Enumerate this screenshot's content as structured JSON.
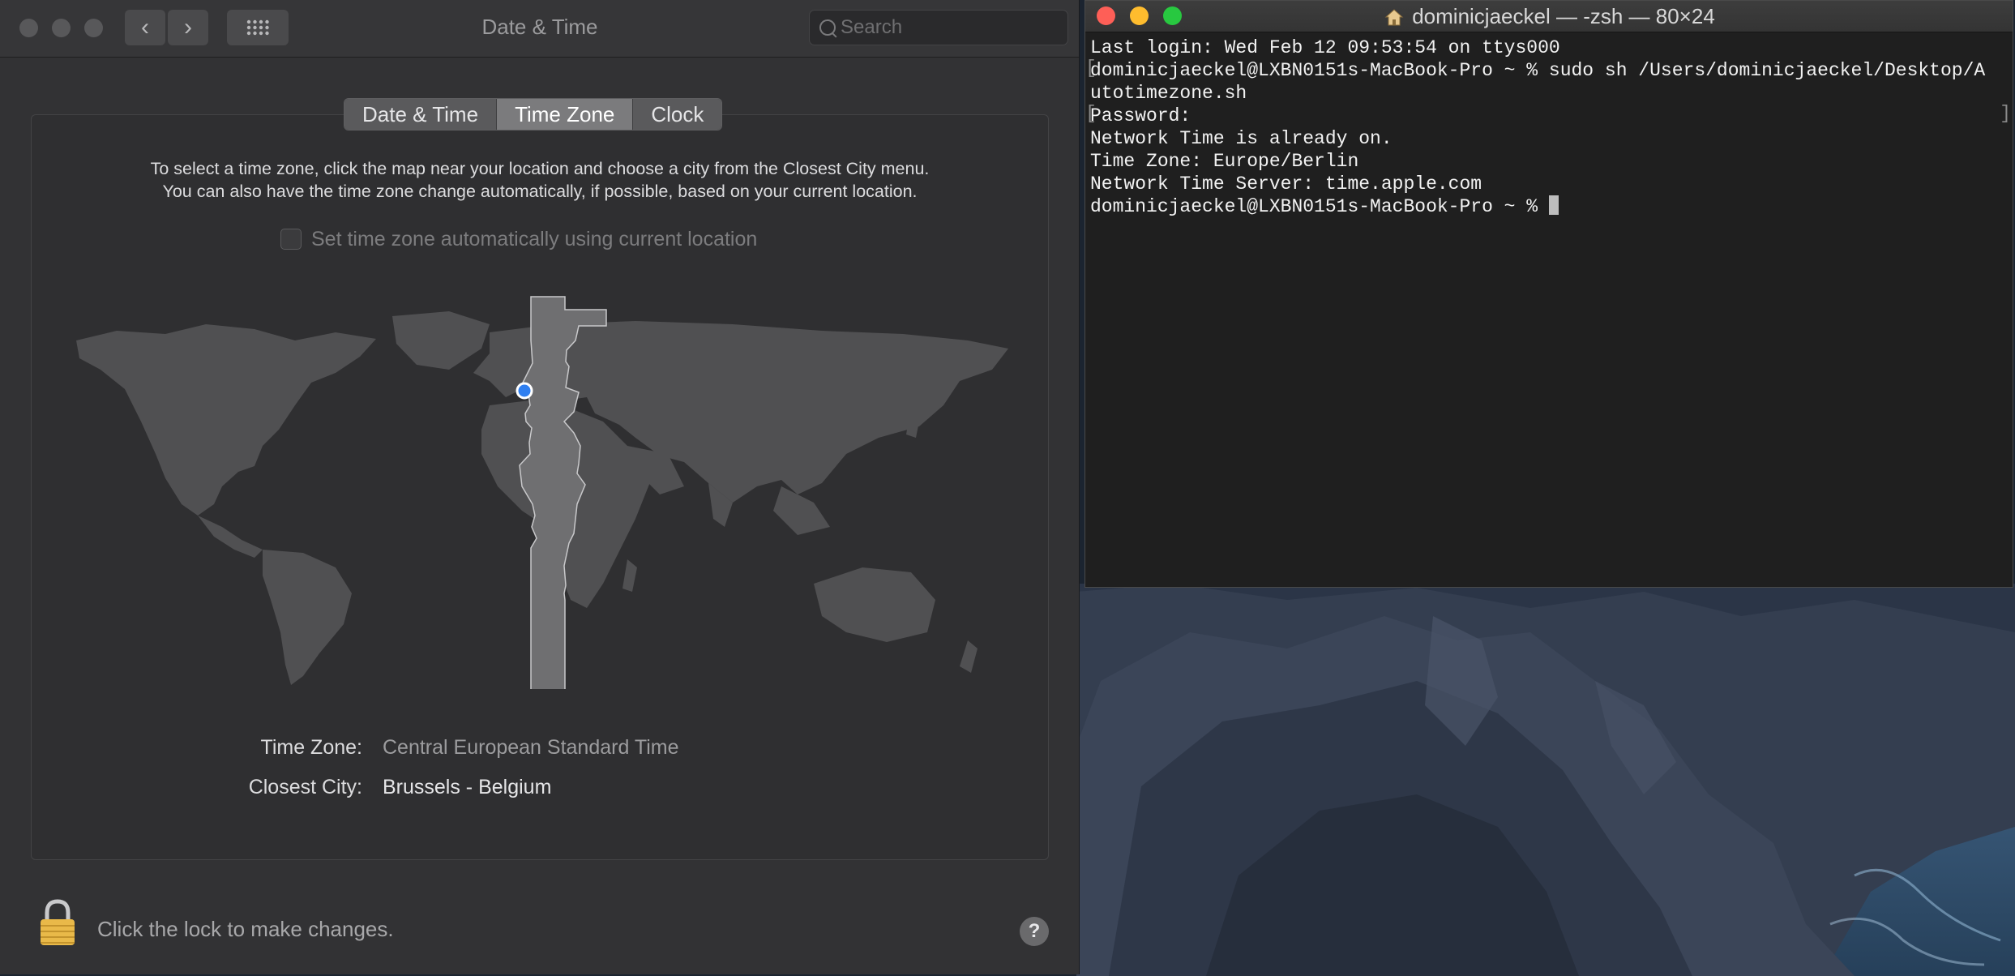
{
  "prefs": {
    "title": "Date & Time",
    "search_placeholder": "Search",
    "nav": {
      "back_glyph": "‹",
      "forward_glyph": "›"
    },
    "tabs": [
      {
        "label": "Date & Time",
        "active": false
      },
      {
        "label": "Time Zone",
        "active": true
      },
      {
        "label": "Clock",
        "active": false
      }
    ],
    "instruction_line1": "To select a time zone, click the map near your location and choose a city from the Closest City menu.",
    "instruction_line2": "You can also have the time zone change automatically, if possible, based on your current location.",
    "auto_timezone": {
      "label": "Set time zone automatically using current location",
      "checked": false,
      "enabled": false
    },
    "timezone_label": "Time Zone:",
    "timezone_value": "Central European Standard Time",
    "closest_city_label": "Closest City:",
    "closest_city_value": "Brussels - Belgium",
    "lock_text": "Click the lock to make changes.",
    "help_glyph": "?"
  },
  "terminal": {
    "title": "dominicjaeckel — -zsh — 80×24",
    "lines": [
      "Last login: Wed Feb 12 09:53:54 on ttys000",
      "dominicjaeckel@LXBN0151s-MacBook-Pro ~ % sudo sh /Users/dominicjaeckel/Desktop/A",
      "utotimezone.sh",
      "Password:",
      "Network Time is already on.",
      "Time Zone: Europe/Berlin",
      "Network Time Server: time.apple.com",
      "dominicjaeckel@LXBN0151s-MacBook-Pro ~ % "
    ]
  },
  "colors": {
    "accent_blue": "#2f7ff0",
    "close_red": "#fe5f57",
    "minimize_yellow": "#febc2e",
    "zoom_green": "#28c840",
    "lock_gold": "#e9b949"
  }
}
